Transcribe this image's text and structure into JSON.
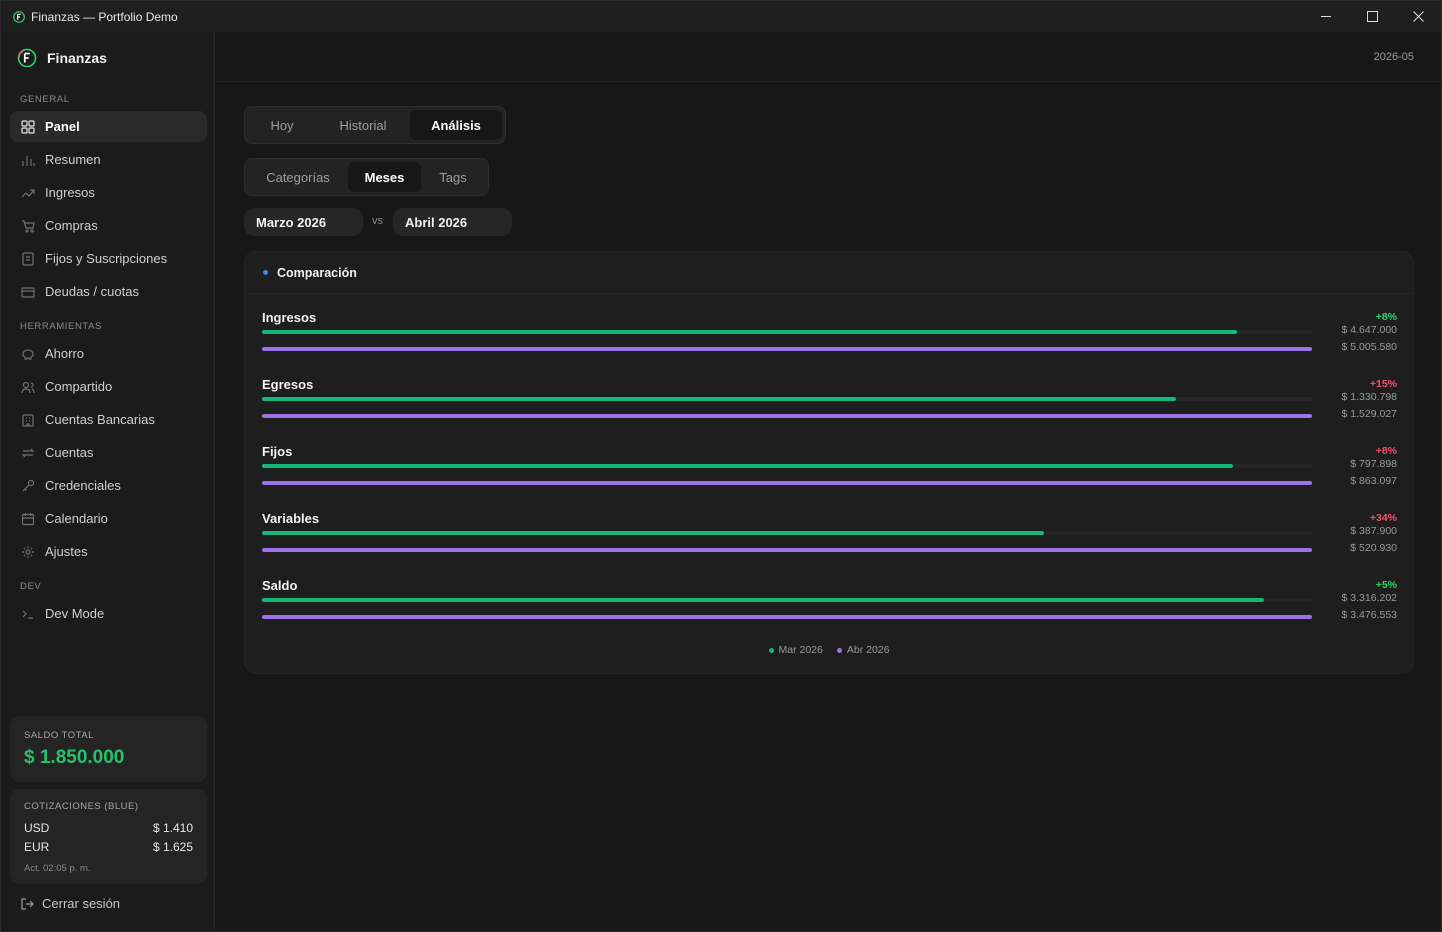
{
  "window": {
    "title": "Finanzas — Portfolio Demo"
  },
  "brand": {
    "name": "Finanzas"
  },
  "sidebar": {
    "sections": [
      {
        "label": "GENERAL"
      },
      {
        "label": "HERRAMIENTAS"
      },
      {
        "label": "DEV"
      }
    ],
    "items": [
      {
        "label": "Panel",
        "icon": "grid-icon"
      },
      {
        "label": "Resumen",
        "icon": "bar-chart-icon"
      },
      {
        "label": "Ingresos",
        "icon": "trending-up-icon"
      },
      {
        "label": "Compras",
        "icon": "cart-icon"
      },
      {
        "label": "Fijos y Suscripciones",
        "icon": "receipt-icon"
      },
      {
        "label": "Deudas / cuotas",
        "icon": "card-icon"
      },
      {
        "label": "Ahorro",
        "icon": "piggy-bank-icon"
      },
      {
        "label": "Compartido",
        "icon": "users-icon"
      },
      {
        "label": "Cuentas Bancarias",
        "icon": "bank-icon"
      },
      {
        "label": "Cuentas",
        "icon": "transfer-icon"
      },
      {
        "label": "Credenciales",
        "icon": "key-icon"
      },
      {
        "label": "Calendario",
        "icon": "calendar-icon"
      },
      {
        "label": "Ajustes",
        "icon": "gear-icon"
      },
      {
        "label": "Dev Mode",
        "icon": "terminal-icon"
      }
    ],
    "saldo": {
      "label": "SALDO TOTAL",
      "value": "$ 1.850.000",
      "color": "#27c26a"
    },
    "cotizaciones": {
      "label": "COTIZACIONES (BLUE)",
      "rows": [
        {
          "currency": "USD",
          "value": "$ 1.410"
        },
        {
          "currency": "EUR",
          "value": "$ 1.625"
        }
      ],
      "updated": "Act. 02:05 p. m."
    },
    "logout": "Cerrar sesión"
  },
  "topbar": {
    "period": "2026-05"
  },
  "tabs": [
    {
      "label": "Hoy",
      "active": false
    },
    {
      "label": "Historial",
      "active": false
    },
    {
      "label": "Análisis",
      "active": true
    }
  ],
  "subtabs": [
    {
      "label": "Categorías",
      "active": false
    },
    {
      "label": "Meses",
      "active": true
    },
    {
      "label": "Tags",
      "active": false
    }
  ],
  "compare": {
    "month_a": "Marzo 2026",
    "vs": "vs",
    "month_b": "Abril 2026"
  },
  "panel": {
    "title": "Comparación"
  },
  "colors": {
    "series_a": "#16b877",
    "series_b": "#9b72e8",
    "up_good": "#2bd46b",
    "up_bad": "#f0506e",
    "accent": "#3b82f6"
  },
  "chart_data": {
    "type": "bar",
    "orientation": "horizontal",
    "title": "Comparación",
    "categories": [
      "Ingresos",
      "Egresos",
      "Fijos",
      "Variables",
      "Saldo"
    ],
    "series": [
      {
        "name": "Mar 2026",
        "values": [
          4647000,
          1330798,
          797898,
          387900,
          3316202
        ],
        "labels": [
          "$ 4.647.000",
          "$ 1.330.798",
          "$ 797.898",
          "$ 387.900",
          "$ 3.316.202"
        ]
      },
      {
        "name": "Abr 2026",
        "values": [
          5005580,
          1529027,
          863097,
          520930,
          3476553
        ],
        "labels": [
          "$ 5.005.580",
          "$ 1.529.027",
          "$ 863.097",
          "$ 520.930",
          "$ 3.476.553"
        ]
      }
    ],
    "changes": [
      {
        "label": "+8%",
        "good": true
      },
      {
        "label": "+15%",
        "good": false
      },
      {
        "label": "+8%",
        "good": false
      },
      {
        "label": "+34%",
        "good": false
      },
      {
        "label": "+5%",
        "good": true
      }
    ],
    "legend": [
      "Mar 2026",
      "Abr 2026"
    ],
    "legend_position": "bottom"
  }
}
